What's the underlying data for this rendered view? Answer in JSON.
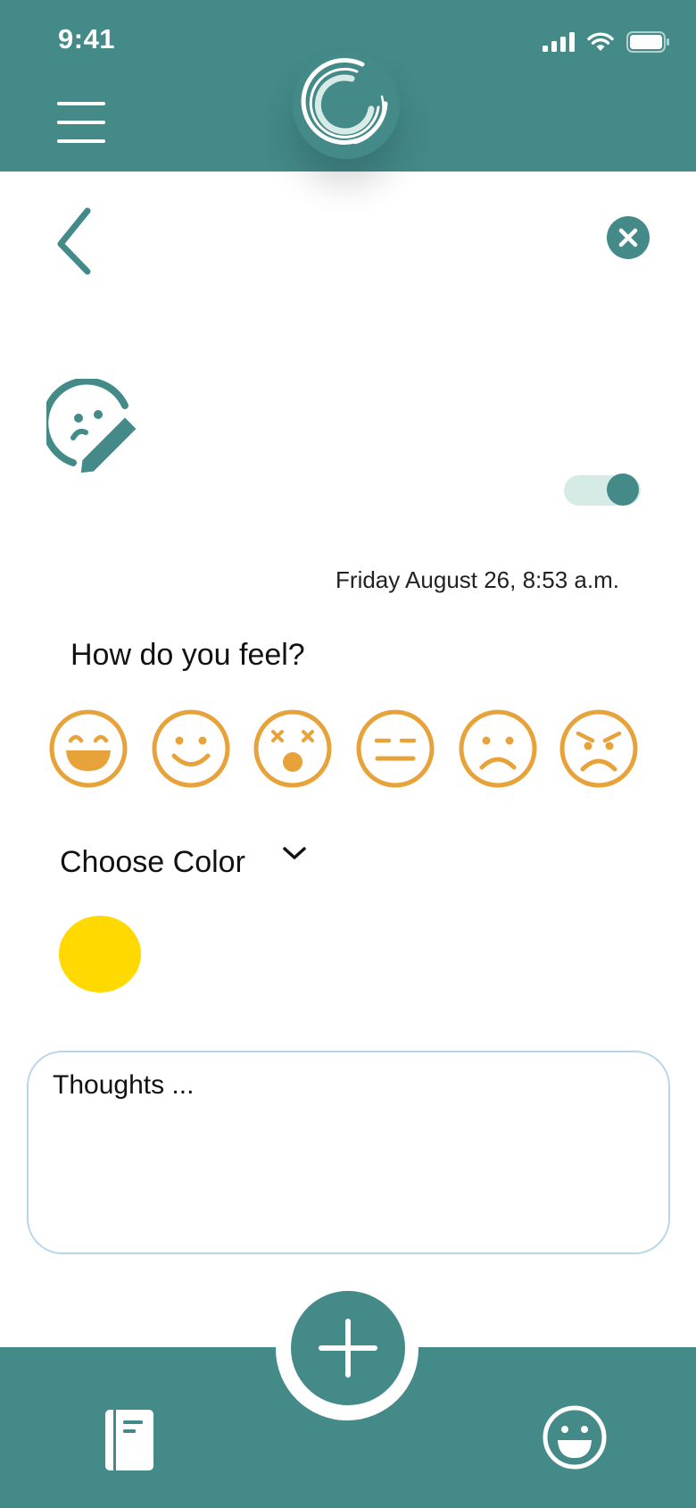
{
  "status_bar": {
    "time": "9:41",
    "icons": [
      "signal-icon",
      "wifi-icon",
      "battery-icon"
    ]
  },
  "header": {
    "menu_icon": "hamburger-icon",
    "logo_icon": "swirl-logo-icon"
  },
  "nav": {
    "back_icon": "chevron-left-icon",
    "close_icon": "close-icon"
  },
  "entry": {
    "mood_edit_icon": "mood-edit-icon",
    "toggle_on": true,
    "date": "Friday August 26, 8:53 a.m.",
    "question": "How do you feel?",
    "moods": [
      "laughing",
      "smiling",
      "shocked",
      "neutral",
      "sad",
      "angry"
    ],
    "choose_color_label": "Choose Color",
    "selected_color": "#FFD900",
    "thoughts_placeholder": "Thoughts ..."
  },
  "bottom_nav": {
    "left_icon": "journal-icon",
    "center_icon": "plus-icon",
    "right_icon": "smile-icon"
  },
  "colors": {
    "primary": "#438A89",
    "mood": "#E8A23A",
    "toggle_track": "#D6EBE6",
    "input_border": "#B7D6EA"
  }
}
